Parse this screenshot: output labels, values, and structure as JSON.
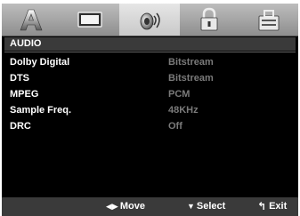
{
  "section_title": "AUDIO",
  "tabs": [
    {
      "icon": "language-icon",
      "active": false
    },
    {
      "icon": "display-icon",
      "active": false
    },
    {
      "icon": "audio-icon",
      "active": true
    },
    {
      "icon": "lock-icon",
      "active": false
    },
    {
      "icon": "others-icon",
      "active": false
    }
  ],
  "settings": [
    {
      "label": "Dolby Digital",
      "value": "Bitstream"
    },
    {
      "label": "DTS",
      "value": "Bitstream"
    },
    {
      "label": "MPEG",
      "value": "PCM"
    },
    {
      "label": "Sample Freq.",
      "value": "48KHz"
    },
    {
      "label": "DRC",
      "value": "Off"
    }
  ],
  "hints": {
    "move_glyph": "◀▶",
    "move_label": "Move",
    "select_glyph": "▼",
    "select_label": "Select",
    "exit_glyph": "↰",
    "exit_label": "Exit"
  },
  "colors": {
    "background": "#000000",
    "tabbar": "#a9a9a9",
    "active_tab": "#d8d8d8",
    "label": "#ffffff",
    "value": "#7a7a7a",
    "header_bar": "#3a3a3a"
  }
}
